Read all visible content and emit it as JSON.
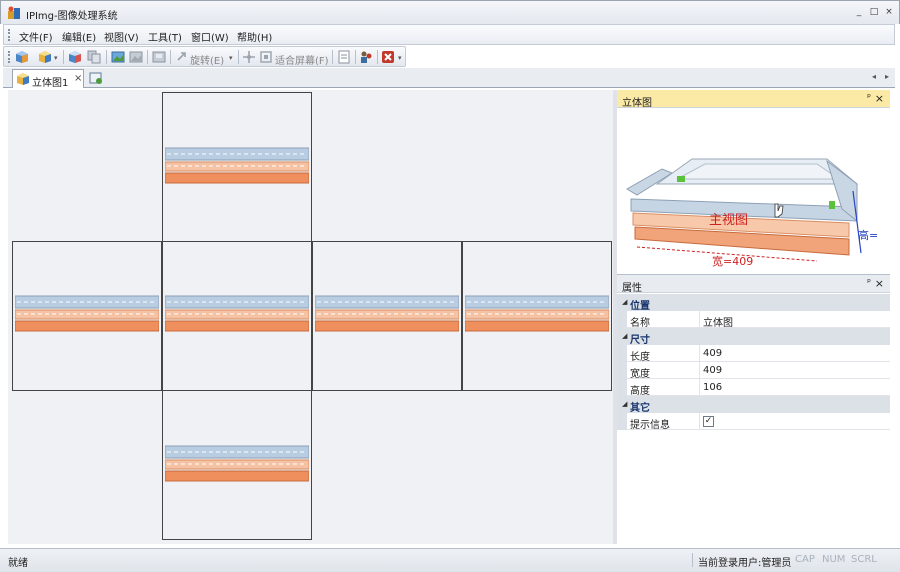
{
  "window": {
    "title": "IPImg-图像处理系统",
    "controls": [
      "_",
      "□",
      "×"
    ]
  },
  "menu": [
    {
      "label": "文件(F)"
    },
    {
      "label": "编辑(E)"
    },
    {
      "label": "视图(V)"
    },
    {
      "label": "工具(T)"
    },
    {
      "label": "窗口(W)"
    },
    {
      "label": "帮助(H)"
    }
  ],
  "toolbar": {
    "rotate_label": "旋转(E)",
    "fit_label": "适合屏幕(F)",
    "icons": [
      "open-cube-icon",
      "new-cube-icon",
      "cube-view-icon",
      "copy-icon",
      "image-add-icon",
      "image-icon",
      "image-save-icon",
      "rotate-icon",
      "move-icon",
      "fit-screen-icon",
      "document-icon",
      "users-icon",
      "close-red-icon"
    ]
  },
  "tabs": {
    "active_label": "立体图1",
    "close": "×",
    "nav_left": "◂",
    "nav_right": "▸"
  },
  "preview_panel": {
    "title": "立体图",
    "pin": "ᵖ",
    "close": "×",
    "scene_labels": {
      "front": "主视图",
      "width": "宽=409",
      "height": "高="
    }
  },
  "properties_panel": {
    "title": "属性",
    "pin": "ᵖ",
    "close": "×",
    "categories": [
      {
        "label": "位置",
        "props": [
          {
            "name": "名称",
            "value": "立体图"
          }
        ]
      },
      {
        "label": "尺寸",
        "props": [
          {
            "name": "长度",
            "value": "409"
          },
          {
            "name": "宽度",
            "value": "409"
          },
          {
            "name": "高度",
            "value": "106"
          }
        ]
      },
      {
        "label": "其它",
        "props": [
          {
            "name": "提示信息",
            "value": "✓",
            "type": "checkbox",
            "checked": true
          }
        ]
      }
    ]
  },
  "status": {
    "left": "就绪",
    "user": "当前登录用户:管理员",
    "keys": [
      "CAP",
      "NUM",
      "SCRL"
    ]
  },
  "colors": {
    "accent_header": "#fbeaa6",
    "slab_blue": "#b9cde2",
    "slab_peach": "#f5c3a3",
    "slab_orange": "#ef8f5e",
    "close_red": "#c0392b"
  }
}
